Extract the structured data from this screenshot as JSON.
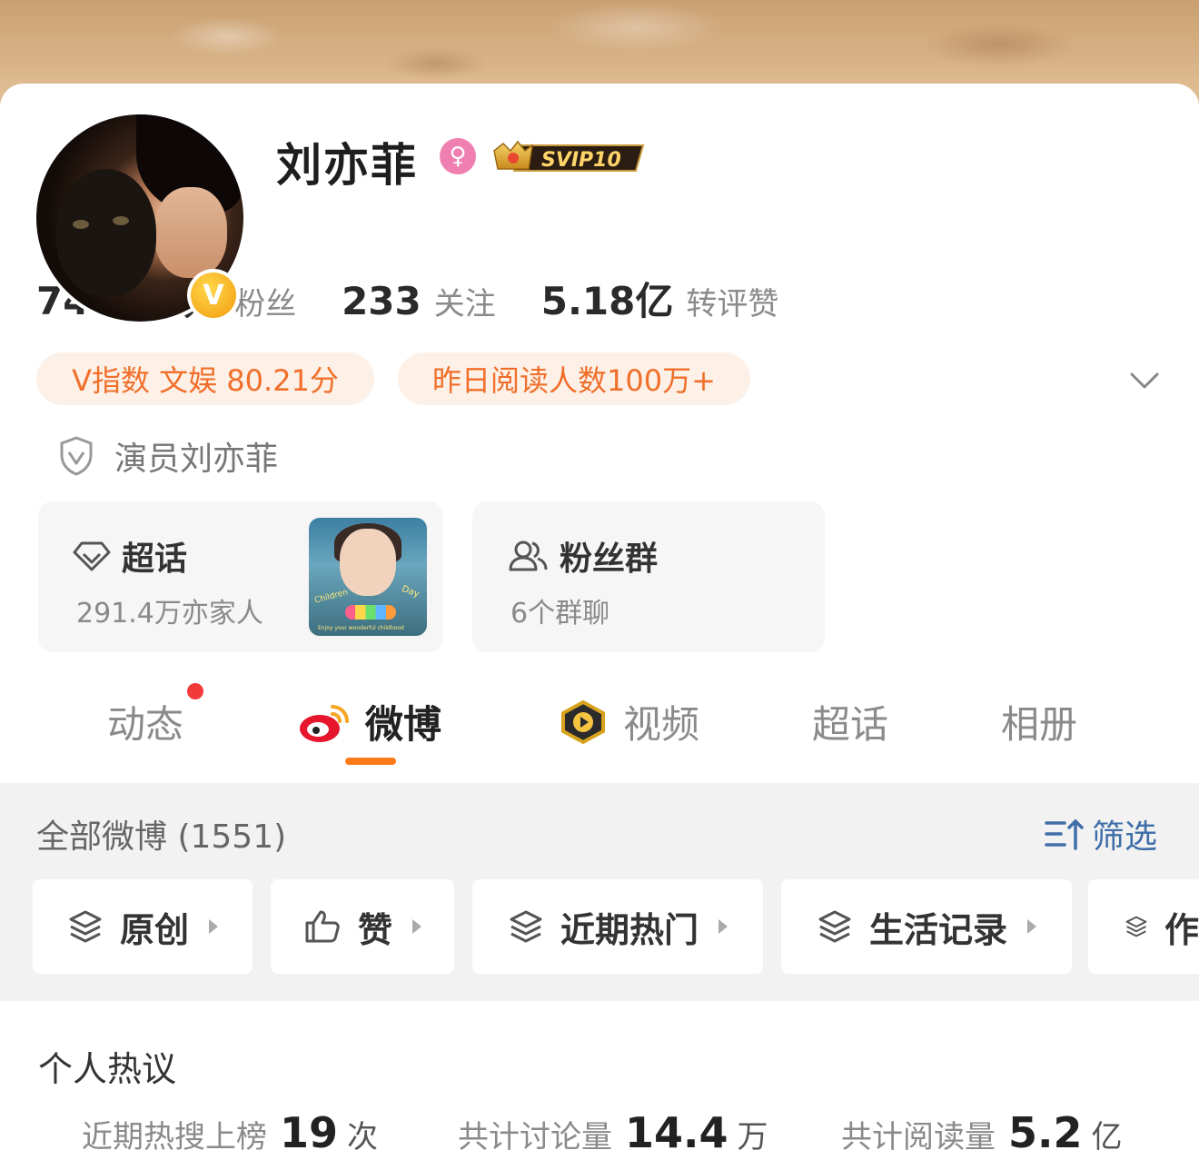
{
  "profile": {
    "name": "刘亦菲",
    "gender_icon": "female-icon",
    "svip_label": "SVIP10",
    "verified_badge": "V"
  },
  "stats": [
    {
      "num": "7440.2万",
      "label": "粉丝"
    },
    {
      "num": "233",
      "label": "关注"
    },
    {
      "num": "5.18亿",
      "label": "转评赞"
    }
  ],
  "pills": {
    "v_index": "V指数 文娱 80.21分",
    "reads": "昨日阅读人数100万+"
  },
  "auth": {
    "text": "演员刘亦菲"
  },
  "supertopic": {
    "title": "超话",
    "sub": "291.4万亦家人",
    "thumb_text_left": "Children",
    "thumb_text_right": "Day",
    "thumb_caption": "Enjoy your wonderful childhood"
  },
  "fangroup": {
    "title": "粉丝群",
    "sub": "6个群聊"
  },
  "tabs": [
    {
      "label": "动态"
    },
    {
      "label": "微博"
    },
    {
      "label": "视频"
    },
    {
      "label": "超话"
    },
    {
      "label": "相册"
    }
  ],
  "feed": {
    "all_label": "全部微博 (1551)",
    "filter_label": "筛选",
    "chips": [
      {
        "label": "原创"
      },
      {
        "label": "赞"
      },
      {
        "label": "近期热门"
      },
      {
        "label": "生活记录"
      },
      {
        "label": "作"
      }
    ]
  },
  "hot": {
    "title": "个人热议",
    "items": [
      {
        "label": "近期热搜上榜",
        "num": "19",
        "unit": "次"
      },
      {
        "label": "共计讨论量",
        "num": "14.4",
        "unit": "万"
      },
      {
        "label": "共计阅读量",
        "num": "5.2",
        "unit": "亿"
      }
    ]
  },
  "colors": {
    "accent": "#ff7a1a",
    "pill_bg": "#fdf0e7",
    "pill_text": "#f06f2a",
    "link_blue": "#3f6ea8"
  }
}
